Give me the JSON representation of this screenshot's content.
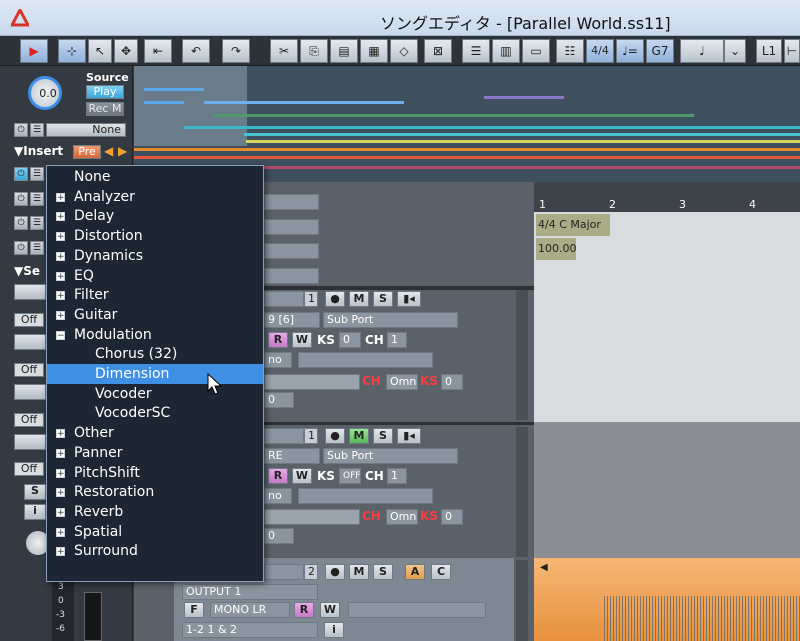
{
  "window": {
    "title": "ソングエディタ - [Parallel World.ss11]"
  },
  "toolbar": {
    "time_sig": "4/4",
    "tempo_icon": "♩=",
    "chord": "G7",
    "note": "♩",
    "lane": "L1"
  },
  "source": {
    "label": "Source",
    "knob": "0.0",
    "play": "Play",
    "rec": "Rec M",
    "none": "None"
  },
  "insert": {
    "label": "▼Insert",
    "pre": "Pre",
    "se_label": "▼Se",
    "off": "Off",
    "s": "S",
    "i": "i"
  },
  "menu": {
    "items": [
      {
        "label": "None",
        "expand": "",
        "indent": false,
        "selected": false
      },
      {
        "label": "Analyzer",
        "expand": "+",
        "indent": false,
        "selected": false
      },
      {
        "label": "Delay",
        "expand": "+",
        "indent": false,
        "selected": false
      },
      {
        "label": "Distortion",
        "expand": "+",
        "indent": false,
        "selected": false
      },
      {
        "label": "Dynamics",
        "expand": "+",
        "indent": false,
        "selected": false
      },
      {
        "label": "EQ",
        "expand": "+",
        "indent": false,
        "selected": false
      },
      {
        "label": "Filter",
        "expand": "+",
        "indent": false,
        "selected": false
      },
      {
        "label": "Guitar",
        "expand": "+",
        "indent": false,
        "selected": false
      },
      {
        "label": "Modulation",
        "expand": "−",
        "indent": false,
        "selected": false
      },
      {
        "label": "Chorus (32)",
        "expand": "",
        "indent": true,
        "selected": false
      },
      {
        "label": "Dimension",
        "expand": "",
        "indent": true,
        "selected": true
      },
      {
        "label": "Vocoder",
        "expand": "",
        "indent": true,
        "selected": false
      },
      {
        "label": "VocoderSC",
        "expand": "",
        "indent": true,
        "selected": false
      },
      {
        "label": "Other",
        "expand": "+",
        "indent": false,
        "selected": false
      },
      {
        "label": "Panner",
        "expand": "+",
        "indent": false,
        "selected": false
      },
      {
        "label": "PitchShift",
        "expand": "+",
        "indent": false,
        "selected": false
      },
      {
        "label": "Restoration",
        "expand": "+",
        "indent": false,
        "selected": false
      },
      {
        "label": "Reverb",
        "expand": "+",
        "indent": false,
        "selected": false
      },
      {
        "label": "Spatial",
        "expand": "+",
        "indent": false,
        "selected": false
      },
      {
        "label": "Surround",
        "expand": "+",
        "indent": false,
        "selected": false
      }
    ]
  },
  "tracks": {
    "t1": {
      "num": "1",
      "port": "Sub Port",
      "field": "9 [6]",
      "ks": "0",
      "ch": "1",
      "mono": "no",
      "omni": "Omni",
      "ks2": "0",
      "zero": "0"
    },
    "t2": {
      "num": "1",
      "port": "Sub Port",
      "field": "RE",
      "ks": "OFF",
      "ch": "1",
      "mono": "no",
      "omni": "Omni",
      "ks2": "0",
      "zero": "0"
    },
    "t3": {
      "num": "2",
      "output": "OUTPUT 1",
      "mono": "MONO LR",
      "route": "1-2 1 & 2",
      "f": "F",
      "i": "i"
    }
  },
  "labels": {
    "m": "M",
    "s": "S",
    "r": "R",
    "w": "W",
    "ks": "KS",
    "ch": "CH",
    "a": "A",
    "c": "C"
  },
  "timeline": {
    "bars": [
      "1",
      "2",
      "3",
      "4"
    ],
    "key": "4/4 C Major",
    "tempo": "100.00"
  },
  "meter": {
    "ticks": [
      "3",
      "0",
      "-3",
      "-6"
    ]
  }
}
